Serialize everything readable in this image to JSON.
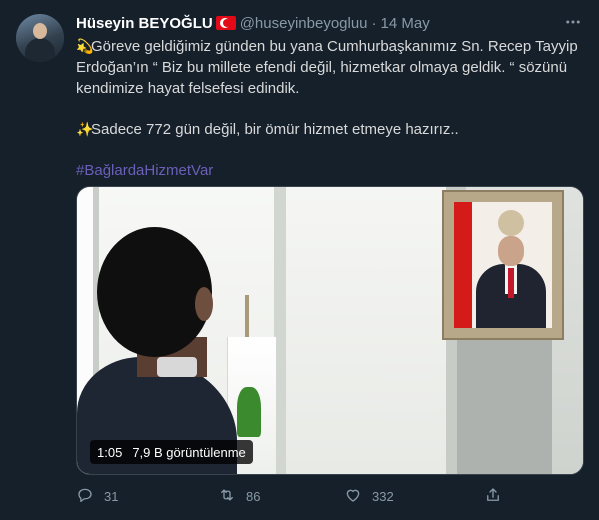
{
  "tweet": {
    "author_name": "Hüseyin BEYOĞLU",
    "handle": "@huseyinbeyogluu",
    "separator": "·",
    "date": "14 May",
    "paragraph1_emoji": "💫",
    "paragraph1_text": "Göreve geldiğimiz günden bu yana Cumhurbaşkanımız Sn. Recep Tayyip Erdoğan’ın “ Biz bu millete efendi değil, hizmetkar olmaya geldik. “ sözünü kendimize hayat felsefesi edindik.",
    "paragraph2_emoji": "✨",
    "paragraph2_text": "Sadece 772 gün değil, bir ömür hizmet etmeye hazırız..",
    "hashtag": "#BağlardaHizmetVar"
  },
  "video": {
    "duration": "1:05",
    "views": "7,9 B görüntülenme"
  },
  "actions": {
    "reply_count": "31",
    "retweet_count": "86",
    "like_count": "332"
  },
  "icons": [
    "more-icon",
    "reply-icon",
    "retweet-icon",
    "like-icon",
    "share-icon",
    "turkish-flag-icon"
  ],
  "colors": {
    "background": "#15202b",
    "hashtag": "#6b5fb8",
    "secondary_text": "#8899a6"
  }
}
